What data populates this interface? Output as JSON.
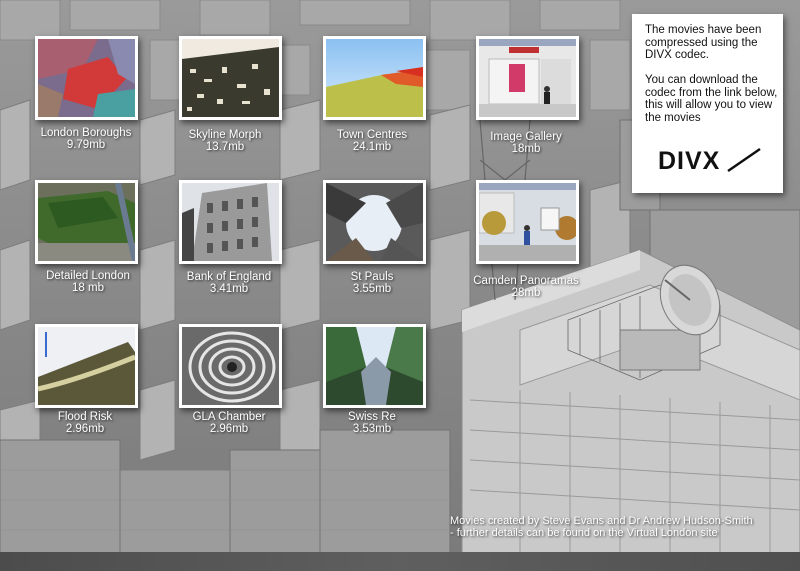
{
  "info_panel": {
    "line1": "The movies have been compressed using the DIVX codec.",
    "line2": "You can download the codec from the link below, this will allow you to view the movies",
    "logo_text": "DIVX",
    "logo_icon": "divx-logo"
  },
  "movies": [
    {
      "title": "London Boroughs",
      "size": "9.79mb"
    },
    {
      "title": "Skyline Morph",
      "size": "13.7mb"
    },
    {
      "title": "Town Centres",
      "size": "24.1mb"
    },
    {
      "title": "Image Gallery",
      "size": "18mb"
    },
    {
      "title": "Detailed London",
      "size": "18 mb"
    },
    {
      "title": "Bank of England",
      "size": "3.41mb"
    },
    {
      "title": "St Pauls",
      "size": "3.55mb"
    },
    {
      "title": "Camden Panoramas",
      "size": "28mb"
    },
    {
      "title": "Flood Risk",
      "size": "2.96mb"
    },
    {
      "title": "GLA Chamber",
      "size": "2.96mb"
    },
    {
      "title": "Swiss Re",
      "size": "3.53mb"
    }
  ],
  "credits": {
    "line1": "Movies created by Steve Evans and Dr Andrew Hudson-Smith",
    "line2": "- further details can be found on the Virtual London site"
  },
  "colors": {
    "background": "#8e8e8e",
    "panel": "#ffffff",
    "caption_text": "#ffffff"
  }
}
